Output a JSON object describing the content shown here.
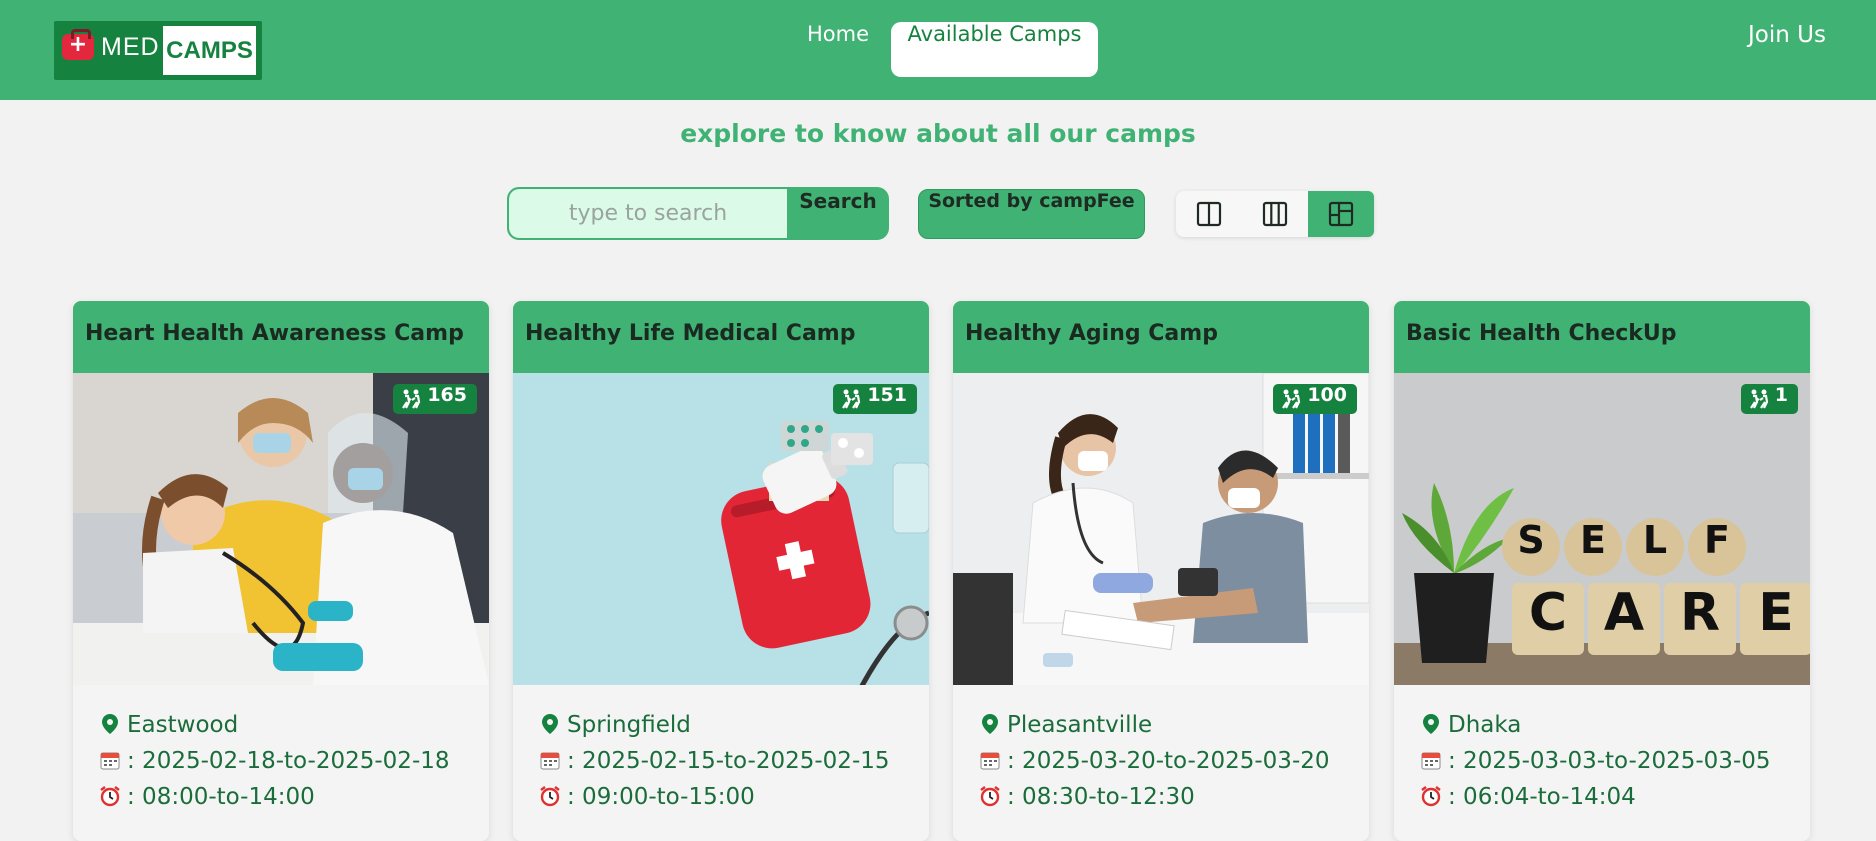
{
  "brand": {
    "med": "MED",
    "camps": "CAMPS"
  },
  "nav": {
    "home": "Home",
    "available": "Available Camps",
    "join": "Join Us"
  },
  "subtitle": "explore to know about all our camps",
  "search": {
    "placeholder": "type to search",
    "button": "Search"
  },
  "sort": {
    "label": "Sorted by campFee"
  },
  "layout_toggle": {
    "options": [
      "two-column",
      "three-column",
      "mixed-grid"
    ],
    "active": "mixed-grid"
  },
  "colors": {
    "primary": "#40b274",
    "dark_green": "#15833f",
    "text_green": "#1a6d3a",
    "search_bg": "#dbfbe8",
    "page_bg": "#f2f2f2"
  },
  "camps": [
    {
      "title": "Heart Health Awareness Camp",
      "participants": "165",
      "location": "Eastwood",
      "dates": ": 2025-02-18-to-2025-02-18",
      "time": ": 08:00-to-14:00"
    },
    {
      "title": "Healthy Life Medical Camp",
      "participants": "151",
      "location": "Springfield",
      "dates": ": 2025-02-15-to-2025-02-15",
      "time": ": 09:00-to-15:00"
    },
    {
      "title": "Healthy Aging Camp",
      "participants": "100",
      "location": "Pleasantville",
      "dates": ": 2025-03-20-to-2025-03-20",
      "time": ": 08:30-to-12:30"
    },
    {
      "title": "Basic Health CheckUp",
      "participants": "1",
      "location": "Dhaka",
      "dates": ": 2025-03-03-to-2025-03-05",
      "time": ": 06:04-to-14:04"
    }
  ],
  "self_care_blocks": {
    "row1": [
      "S",
      "E",
      "L",
      "F"
    ],
    "row2": [
      "C",
      "A",
      "R",
      "E"
    ]
  }
}
